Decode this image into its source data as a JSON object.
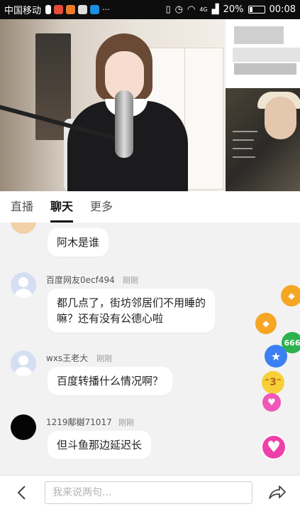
{
  "status_bar": {
    "carrier": "中国移动",
    "network": "4G",
    "battery": "20%",
    "battery_level": 0.2,
    "time": "00:08"
  },
  "tabs": [
    {
      "label": "直播",
      "active": false
    },
    {
      "label": "聊天",
      "active": true
    },
    {
      "label": "更多",
      "active": false
    }
  ],
  "messages": [
    {
      "user": "",
      "time": "",
      "text": "阿木是谁"
    },
    {
      "user": "百度网友0ecf494",
      "time": "刚刚",
      "text_line1": "都几点了，街坊邻居们不用睡的",
      "text_line2": "嘛？还有没有公德心啦"
    },
    {
      "user": "wxs王老大",
      "time": "刚刚",
      "text": "百度转播什么情况啊？"
    },
    {
      "user": "1219鄅樾71017",
      "time": "刚刚",
      "text": "但斗鱼那边延迟长"
    }
  ],
  "gifts": [
    {
      "icon": "diamond-icon",
      "color": "#f5a623"
    },
    {
      "icon": "diamond-icon",
      "color": "#f5a623"
    },
    {
      "icon": "badge-666-icon",
      "label": "666",
      "color": "#2bb24c"
    },
    {
      "icon": "star-icon",
      "color": "#3b7ff5"
    },
    {
      "icon": "kiss-emoji-icon",
      "color": "#f7d038"
    },
    {
      "icon": "heart-icon",
      "color": "#f057b8"
    },
    {
      "icon": "heart-icon",
      "color": "#ef3fa8"
    }
  ],
  "input": {
    "placeholder": "我来说两句..."
  }
}
